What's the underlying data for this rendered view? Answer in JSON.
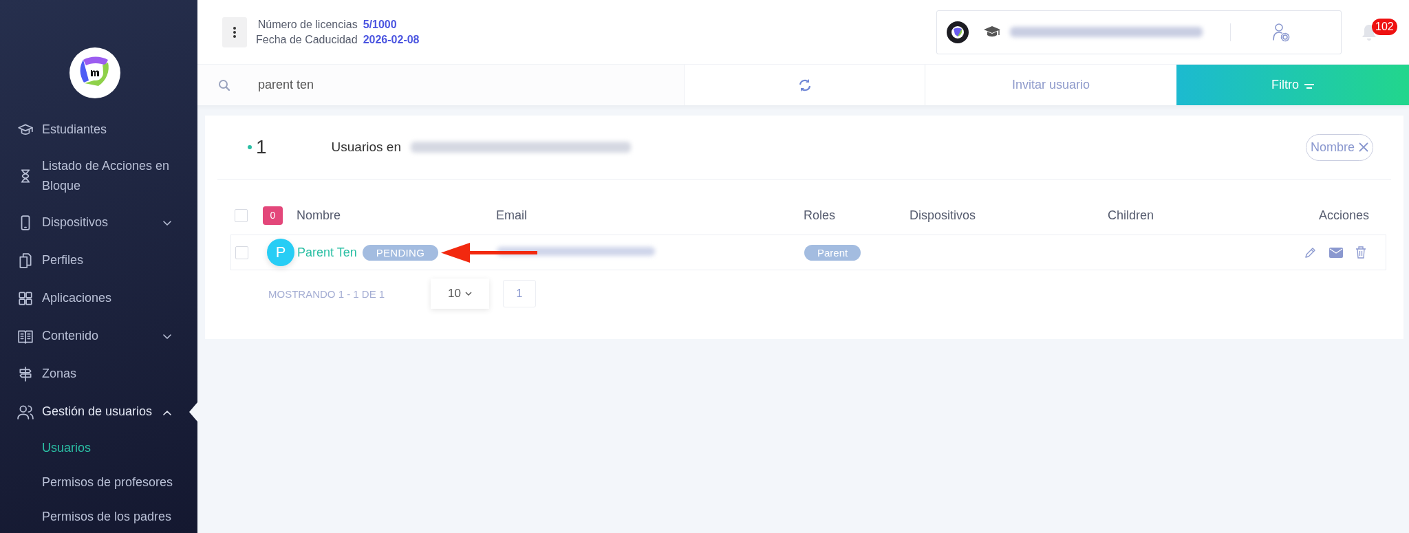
{
  "sidebar": {
    "items": [
      {
        "label": "Estudiantes",
        "kind": "link",
        "selected": false
      },
      {
        "label": "Listado de Acciones en Bloque",
        "kind": "link",
        "selected": false
      },
      {
        "label": "Dispositivos",
        "kind": "group",
        "expanded": false,
        "selected": false
      },
      {
        "label": "Perfiles",
        "kind": "link",
        "selected": false
      },
      {
        "label": "Aplicaciones",
        "kind": "link",
        "selected": false
      },
      {
        "label": "Contenido",
        "kind": "group",
        "expanded": false,
        "selected": false
      },
      {
        "label": "Zonas",
        "kind": "link",
        "selected": false
      },
      {
        "label": "Gestión de usuarios",
        "kind": "group",
        "expanded": true,
        "selected": true,
        "children": [
          {
            "label": "Usuarios",
            "selected": true
          },
          {
            "label": "Permisos de profesores",
            "selected": false
          },
          {
            "label": "Permisos de los padres",
            "selected": false
          }
        ]
      }
    ]
  },
  "header": {
    "licenses_label": "Número de licencias",
    "licenses_value": "5/1000",
    "expiry_label": "Fecha de Caducidad",
    "expiry_value": "2026-02-08",
    "notifications_count": "102"
  },
  "toolbar": {
    "search_value": "parent ten",
    "invite_button": "Invitar usuario",
    "filter_button": "Filtro"
  },
  "summary": {
    "count": "1",
    "title": "Usuarios en",
    "filter_chip": "Nombre"
  },
  "table": {
    "select_all_checked": false,
    "selected_count": "0",
    "columns": [
      "Nombre",
      "Email",
      "Roles",
      "Dispositivos",
      "Children",
      "Acciones"
    ],
    "rows": [
      {
        "checked": false,
        "avatar": "P",
        "name": "Parent Ten",
        "status": "PENDING",
        "role": "Parent"
      }
    ]
  },
  "pagination": {
    "info": "MOSTRANDO 1 - 1 DE 1",
    "page_size": "10",
    "page": "1"
  }
}
